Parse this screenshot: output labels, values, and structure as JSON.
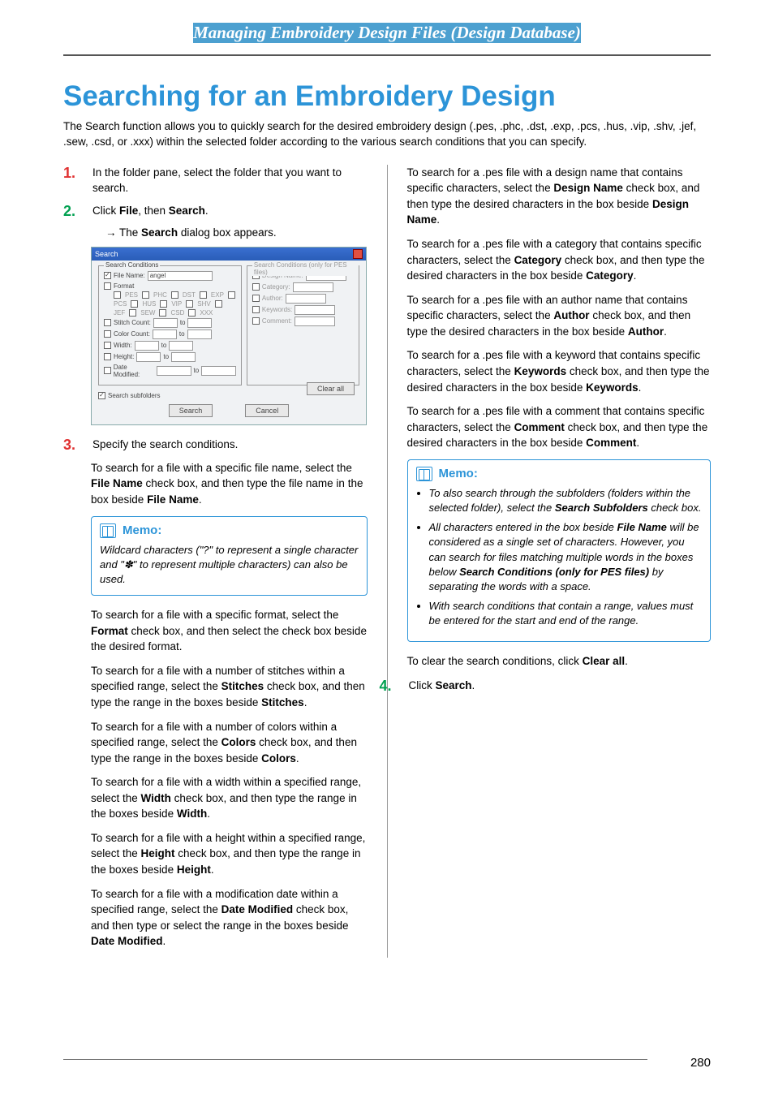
{
  "header": {
    "title": "Managing Embroidery Design Files (Design Database)"
  },
  "title": "Searching for an Embroidery Design",
  "intro": "The Search function allows you to quickly search for the desired embroidery design (.pes, .phc, .dst, .exp, .pcs, .hus, .vip, .shv, .jef, .sew, .csd, or .xxx) within the selected folder according to the various search conditions that you can specify.",
  "steps": {
    "s1": {
      "num": "1.",
      "text_a": "In the folder pane, select the folder that you want to search."
    },
    "s2": {
      "num": "2.",
      "text_a": "Click ",
      "file": "File",
      "text_b": ", then ",
      "search": "Search",
      "text_c": "."
    },
    "s2_arrow": {
      "arrow": "→ The ",
      "bold": "Search",
      "rest": " dialog box appears."
    },
    "s3": {
      "num": "3.",
      "text_a": "Specify the search conditions."
    },
    "s4": {
      "num": "4.",
      "text_a": "Click ",
      "bold": "Search",
      "text_b": "."
    }
  },
  "dialog": {
    "title": "Search",
    "group1": "Search Conditions",
    "group2": "Search Conditions (only for PES files)",
    "filename_lbl": "File Name:",
    "filename_val": "angel",
    "format_lbl": "Format",
    "formats": [
      "PES",
      "PHC",
      "DST",
      "EXP",
      "PCS",
      "HUS",
      "VIP",
      "SHV",
      "JEF",
      "SEW",
      "CSD",
      "XXX"
    ],
    "stitch_lbl": "Stitch Count:",
    "color_lbl": "Color Count:",
    "width_lbl": "Width:",
    "height_lbl": "Height:",
    "date_lbl": "Date Modified:",
    "to": "to",
    "design_lbl": "Design Name:",
    "category_lbl": "Category:",
    "author_lbl": "Author:",
    "keywords_lbl": "Keywords:",
    "comment_lbl": "Comment:",
    "subfolders": "Search subfolders",
    "btn_search": "Search",
    "btn_cancel": "Cancel",
    "btn_clear": "Clear all"
  },
  "left": {
    "p1_a": "To search for a file with a specific file name, select the ",
    "p1_b": "File Name",
    "p1_c": " check box, and then type the file name in the box beside ",
    "p1_d": "File Name",
    "p1_e": ".",
    "memo1_title": "Memo:",
    "memo1_text": "Wildcard characters (\"?\" to represent a single character and \"✽\" to represent multiple characters) can also be used.",
    "p2_a": "To search for a file with a specific format, select the ",
    "p2_b": "Format",
    "p2_c": " check box, and then select the check box beside the desired format.",
    "p3_a": "To search for a file with a number of stitches within a specified range, select the ",
    "p3_b": "Stitches",
    "p3_c": " check box, and then type the range in the boxes beside ",
    "p3_d": "Stitches",
    "p3_e": ".",
    "p4_a": "To search for a file with a number of colors within a specified range, select the ",
    "p4_b": "Colors",
    "p4_c": " check box, and then type the range in the boxes beside ",
    "p4_d": "Colors",
    "p4_e": ".",
    "p5_a": "To search for a file with a width within a specified range, select the ",
    "p5_b": "Width",
    "p5_c": " check box, and then type the range in the boxes beside ",
    "p5_d": "Width",
    "p5_e": ".",
    "p6_a": "To search for a file with a height within a specified range, select the ",
    "p6_b": "Height",
    "p6_c": " check box, and then type the range in the boxes beside ",
    "p6_d": "Height",
    "p6_e": ".",
    "p7_a": "To search for a file with a modification date within a specified range, select the ",
    "p7_b": "Date Modified",
    "p7_c": " check box, and then type or select the range in the boxes beside ",
    "p7_d": "Date Modified",
    "p7_e": "."
  },
  "right": {
    "p1_a": "To search for a .pes file with a design name that contains specific characters, select the ",
    "p1_b": "Design Name",
    "p1_c": " check box, and then type the desired characters in the box beside ",
    "p1_d": "Design Name",
    "p1_e": ".",
    "p2_a": "To search for a .pes file with a category that contains specific characters, select the ",
    "p2_b": "Category",
    "p2_c": " check box, and then type the desired characters in the box beside ",
    "p2_d": "Category",
    "p2_e": ".",
    "p3_a": "To search for a .pes file with an author name that contains specific characters, select the ",
    "p3_b": "Author",
    "p3_c": " check box, and then type the desired characters in the box beside ",
    "p3_d": "Author",
    "p3_e": ".",
    "p4_a": "To search for a .pes file with a keyword that contains specific characters, select the ",
    "p4_b": "Keywords",
    "p4_c": " check box, and then type the desired characters in the box beside ",
    "p4_d": "Keywords",
    "p4_e": ".",
    "p5_a": "To search for a .pes file with a comment that contains specific characters, select the ",
    "p5_b": "Comment",
    "p5_c": " check box, and then type the desired characters in the box beside ",
    "p5_d": "Comment",
    "p5_e": ".",
    "memo2_title": "Memo:",
    "memo2_li1_a": "To also search through the subfolders (folders within the selected folder), select the ",
    "memo2_li1_b": "Search Subfolders",
    "memo2_li1_c": " check box.",
    "memo2_li2_a": "All characters entered in the box beside ",
    "memo2_li2_b": "File Name",
    "memo2_li2_c": " will be considered as a single set of characters. However, you can search for files matching multiple words in the boxes below ",
    "memo2_li2_d": "Search Conditions (only for PES files)",
    "memo2_li2_e": " by separating the words with a space.",
    "memo2_li3": "With search conditions that contain a range, values must be entered for the start and end of the range.",
    "p6_a": "To clear the search conditions, click ",
    "p6_b": "Clear all",
    "p6_c": "."
  },
  "footer": {
    "page": "280"
  }
}
